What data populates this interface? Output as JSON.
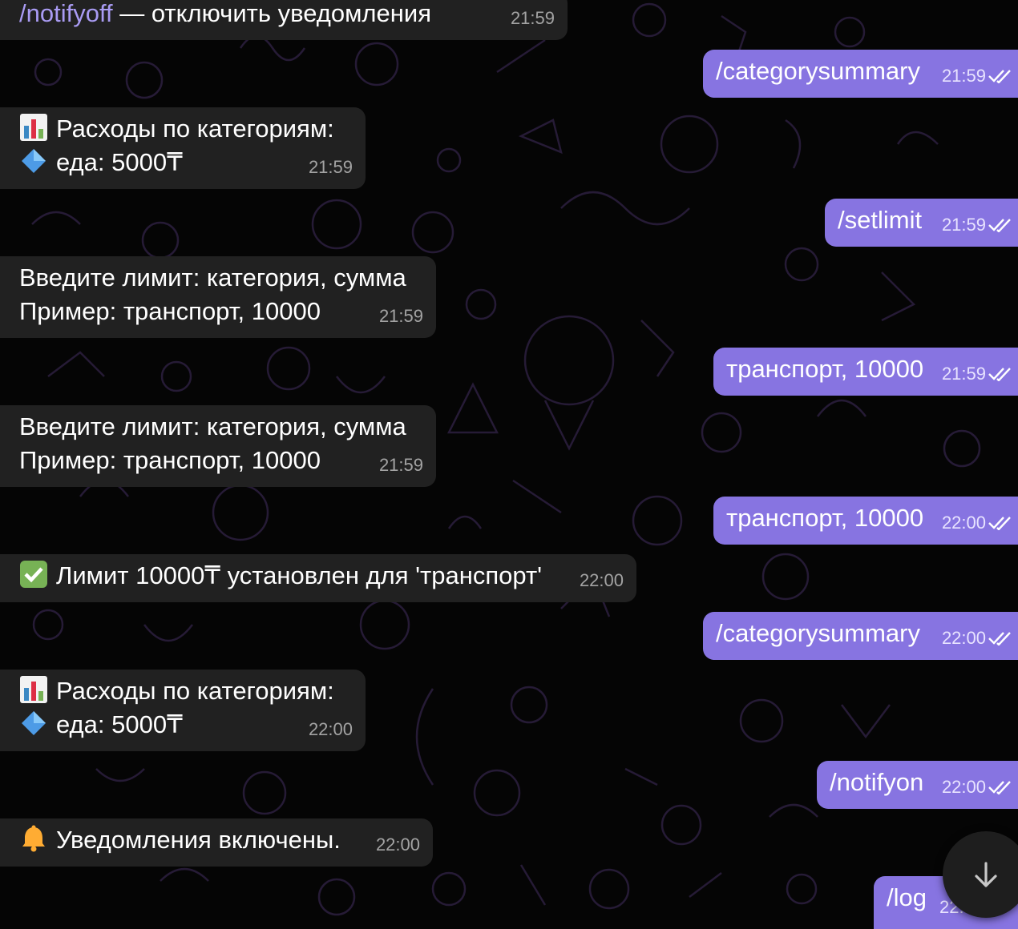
{
  "messages": [
    {
      "prefix": "/notifyoff",
      "text": " — отключить уведомления",
      "time": "21:59"
    },
    {
      "text": "/categorysummary",
      "time": "21:59"
    },
    {
      "line1": "Расходы по категориям:",
      "line2": "еда: 5000₸",
      "time": "21:59",
      "icon1": "bar-chart-emoji",
      "icon2": "blue-diamond-emoji"
    },
    {
      "text": "/setlimit",
      "time": "21:59"
    },
    {
      "line1": "Введите лимит: категория, сумма",
      "line2": "Пример: транспорт, 10000",
      "time": "21:59"
    },
    {
      "text": "транспорт, 10000",
      "time": "21:59"
    },
    {
      "line1": "Введите лимит: категория, сумма",
      "line2": "Пример: транспорт, 10000",
      "time": "21:59"
    },
    {
      "text": "транспорт, 10000",
      "time": "22:00"
    },
    {
      "text": "Лимит 10000₸ установлен для 'транспорт'",
      "time": "22:00",
      "icon": "check-mark-emoji"
    },
    {
      "text": "/categorysummary",
      "time": "22:00"
    },
    {
      "line1": "Расходы по категориям:",
      "line2": "еда: 5000₸",
      "time": "22:00",
      "icon1": "bar-chart-emoji",
      "icon2": "blue-diamond-emoji"
    },
    {
      "text": "/notifyon",
      "time": "22:00"
    },
    {
      "text": "Уведомления включены.",
      "time": "22:00",
      "icon": "bell-emoji"
    },
    {
      "text": "/log",
      "time": "22:"
    }
  ],
  "colors": {
    "outgoing_bubble": "#8774e1",
    "incoming_bubble": "#212121",
    "background": "#050505",
    "command_link": "#a99bf3"
  },
  "scroll_button": {
    "icon": "arrow-down-icon"
  }
}
